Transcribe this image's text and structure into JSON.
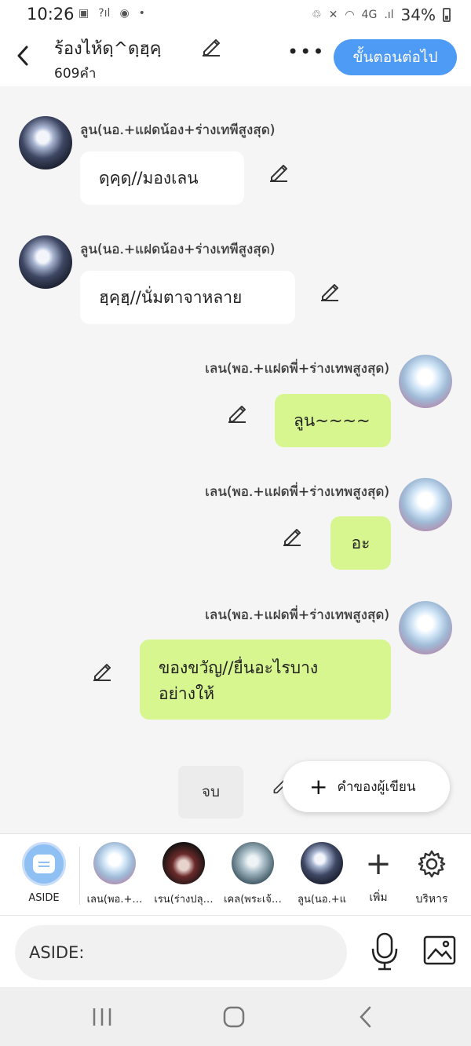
{
  "status_bar": {
    "time": "10:26",
    "battery": "34%",
    "network": "4G"
  },
  "header": {
    "title": "ร้องไห้ดฺ^ดฺฮฺคฺ",
    "word_count": "609คำ",
    "more_icon": "more-dots-icon",
    "next_label": "ขั้นตอนต่อไป"
  },
  "messages": [
    {
      "speaker": "ลูน(นอ.+แฝดน้อง+ร่างเทพีสูงสุด)",
      "text": "ดฺคฺดฺ//มองเลน",
      "side": "left"
    },
    {
      "speaker": "ลูน(นอ.+แฝดน้อง+ร่างเทพีสูงสุด)",
      "text": "ฮฺคฺฮฺ//นั่มตาจาหลาย",
      "side": "left"
    },
    {
      "speaker": "เลน(พอ.+แฝดพี่+ร่างเทพสูงสุด)",
      "text": "ลูน~~~~",
      "side": "right"
    },
    {
      "speaker": "เลน(พอ.+แฝดพี่+ร่างเทพสูงสุด)",
      "text": "อะ",
      "side": "right"
    },
    {
      "speaker": "เลน(พอ.+แฝดพี่+ร่างเทพสูงสุด)",
      "text": "ของขวัญ//ยื่นอะไรบาง\nอย่างให้",
      "side": "right"
    }
  ],
  "end_button": "จบ",
  "author_note_button": "คำของผู้เขียน",
  "characters": [
    {
      "name": "ASIDE"
    },
    {
      "name": "เลน(พอ.+…"
    },
    {
      "name": "เรน(ร่างปลุ…"
    },
    {
      "name": "เคล(พระเจ้…"
    },
    {
      "name": "ลูน(นอ.+แ"
    }
  ],
  "tools": {
    "add_label": "เพิ่ม",
    "manage_label": "บริหาร"
  },
  "input": {
    "placeholder": "ASIDE:"
  },
  "colors": {
    "accent": "#4d9bf5",
    "bubble_right": "#d7f68f",
    "bubble_left": "#ffffff"
  }
}
